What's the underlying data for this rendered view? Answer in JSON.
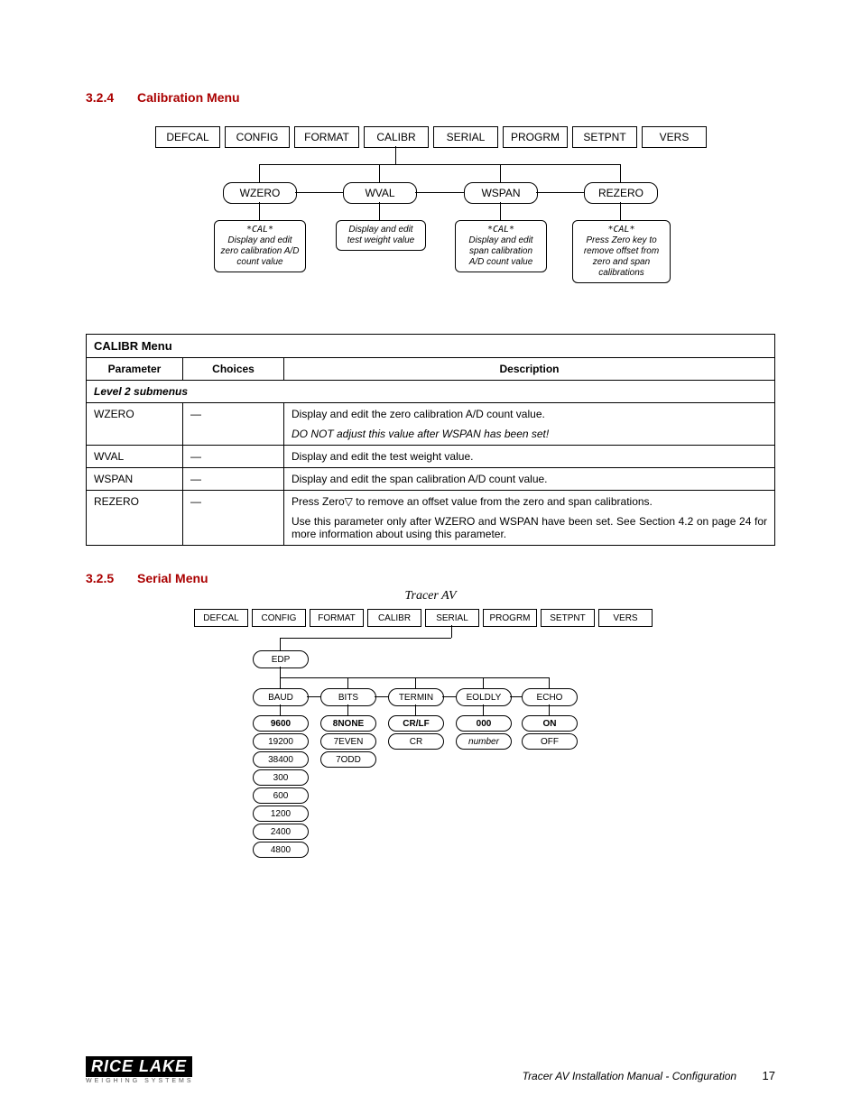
{
  "sections": {
    "calib": {
      "num": "3.2.4",
      "title": "Calibration Menu"
    },
    "serial": {
      "num": "3.2.5",
      "title": "Serial Menu"
    }
  },
  "top_menu": [
    "DEFCAL",
    "CONFIG",
    "FORMAT",
    "CALIBR",
    "SERIAL",
    "PROGRM",
    "SETPNT",
    "VERS"
  ],
  "calib_diagram": {
    "sub": [
      "WZERO",
      "WVAL",
      "WSPAN",
      "REZERO"
    ],
    "notes": {
      "cal": "*CAL*",
      "wzero": "Display and edit zero calibration A/D count value",
      "wval": "Display and edit test weight value",
      "wspan": "Display and edit span calibration A/D count value",
      "rezero": "Press Zero key to remove offset from zero and span calibrations"
    }
  },
  "table": {
    "title": "CALIBR Menu",
    "headers": [
      "Parameter",
      "Choices",
      "Description"
    ],
    "level": "Level 2 submenus",
    "rows": [
      {
        "p": "WZERO",
        "c": "—",
        "d1": "Display and edit the zero calibration A/D count value.",
        "d2": "DO NOT adjust this value after WSPAN has been set!"
      },
      {
        "p": "WVAL",
        "c": "—",
        "d1": "Display and edit the test weight value."
      },
      {
        "p": "WSPAN",
        "c": "—",
        "d1": "Display and edit the span calibration A/D count value."
      },
      {
        "p": "REZERO",
        "c": "—",
        "d1": "Press Zero▽ to remove an offset value from the zero and span calibrations.",
        "d2": "Use this parameter only after WZERO and WSPAN have been set. See Section 4.2 on page 24 for more information about using this parameter."
      }
    ]
  },
  "serial_diagram": {
    "title": "Tracer AV",
    "top": [
      "DEFCAL",
      "CONFIG",
      "FORMAT",
      "CALIBR",
      "SERIAL",
      "PROGRM",
      "SETPNT",
      "VERS"
    ],
    "mid": "EDP",
    "params": [
      "BAUD",
      "BITS",
      "TERMIN",
      "EOLDLY",
      "ECHO"
    ],
    "baud": [
      "9600",
      "19200",
      "38400",
      "300",
      "600",
      "1200",
      "2400",
      "4800"
    ],
    "bits": [
      "8NONE",
      "7EVEN",
      "7ODD"
    ],
    "termin": [
      "CR/LF",
      "CR"
    ],
    "eoldly": [
      "000",
      "number"
    ],
    "echo": [
      "ON",
      "OFF"
    ]
  },
  "footer": {
    "logo_main": "RICE LAKE",
    "logo_sub": "WEIGHING SYSTEMS",
    "doc": "Tracer AV Installation Manual - Configuration",
    "page": "17"
  }
}
